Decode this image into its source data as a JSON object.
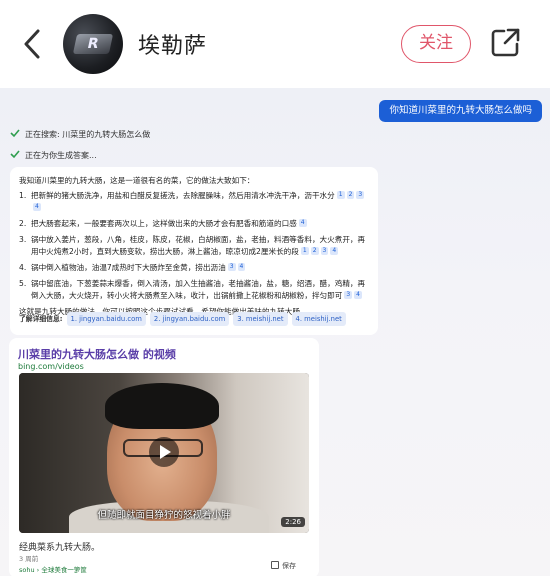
{
  "header": {
    "username": "埃勒萨",
    "avatar_text": "R",
    "follow_label": "关注"
  },
  "chat": {
    "user_query": "你知道川菜里的九转大肠怎么做吗",
    "status_searching": "正在搜索: 川菜里的九转大肠怎么做",
    "status_generating": "正在为你生成答案...",
    "answer_intro": "我知道川菜里的九转大肠，这是一道很有名的菜，它的做法大致如下：",
    "steps": [
      {
        "num": "1.",
        "text": "把新鲜的猪大肠洗净，用盐和白醋反复搓洗，去除腥臊味，然后用清水冲洗干净，沥干水分",
        "cites": [
          "1",
          "2",
          "3",
          "4"
        ]
      },
      {
        "num": "2.",
        "text": "把大肠套起来，一般要套两次以上，这样做出来的大肠才会有肥香和筋道的口感",
        "cites": [
          "4"
        ]
      },
      {
        "num": "3.",
        "text": "锅中放入姜片，葱段，八角，桂皮，陈皮，花椒，白胡椒面，盐，老抽，料酒等香料，大火煮开，再用中火炖煮2小时，直到大肠变软，捞出大肠，淋上酱油，晾凉切成2厘米长的段",
        "cites": [
          "1",
          "2",
          "3",
          "4"
        ]
      },
      {
        "num": "4.",
        "text": "锅中倒入植物油，油温7成热时下大肠炸至金黄，捞出沥油",
        "cites": [
          "3",
          "4"
        ]
      },
      {
        "num": "5.",
        "text": "锅中留底油，下葱姜蒜末爆香，倒入清汤，加入生抽酱油，老抽酱油，盐，糖，绍酒，醋，鸡精，再倒入大肠，大火烧开，转小火将大肠煮至入味，收汁，出锅前撒上花椒粉和胡椒粉，拌匀即可",
        "cites": [
          "3",
          "4"
        ]
      }
    ],
    "answer_outro": "这就是九转大肠的做法，你可以按照这个步骤试试看，希望你能做出美味的九转大肠。",
    "learn_more_label": "了解详细信息:",
    "sources": [
      "1. jingyan.baidu.com",
      "2. jingyan.baidu.com",
      "3. meishij.net",
      "4. meishij.net"
    ]
  },
  "video_card": {
    "title": "川菜里的九转大肠怎么做 的视频",
    "domain": "bing.com/videos",
    "subtitle": "但随即就面目狰狞的怒视着小胖",
    "duration": "2:26",
    "description": "经典菜系九转大肠。",
    "age": "3 周前",
    "source": "sohu › 全球美食一箩筐",
    "save_label": "保存"
  },
  "colors": {
    "accent_blue": "#1c5fd6",
    "follow_red": "#e0566a",
    "check_green": "#2f9e4f",
    "card_title_purple": "#5a3ea8"
  }
}
